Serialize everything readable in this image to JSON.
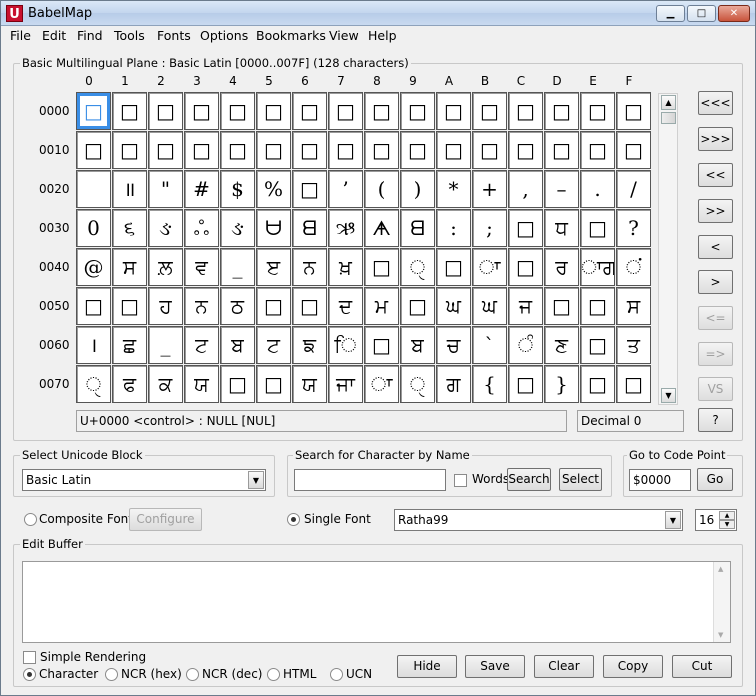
{
  "app": {
    "title": "BabelMap",
    "icon_letter": "U"
  },
  "window_controls": {
    "min": "▁",
    "max": "□",
    "close": "✕"
  },
  "menu": [
    "File",
    "Edit",
    "Find",
    "Tools",
    "Fonts",
    "Options",
    "Bookmarks",
    "View",
    "Help"
  ],
  "grid": {
    "title": "Basic Multilingual Plane : Basic Latin [0000..007F] (128 characters)",
    "columns": [
      "0",
      "1",
      "2",
      "3",
      "4",
      "5",
      "6",
      "7",
      "8",
      "9",
      "A",
      "B",
      "C",
      "D",
      "E",
      "F"
    ],
    "rows": [
      {
        "label": "0000",
        "cells": [
          "□",
          "□",
          "□",
          "□",
          "□",
          "□",
          "□",
          "□",
          "□",
          "□",
          "□",
          "□",
          "□",
          "□",
          "□",
          "□"
        ]
      },
      {
        "label": "0010",
        "cells": [
          "□",
          "□",
          "□",
          "□",
          "□",
          "□",
          "□",
          "□",
          "□",
          "□",
          "□",
          "□",
          "□",
          "□",
          "□",
          "□"
        ]
      },
      {
        "label": "0020",
        "cells": [
          "",
          "॥",
          "\"",
          "#",
          "$",
          "%",
          "□",
          "’",
          "(",
          ")",
          "*",
          "+",
          ",",
          "–",
          ".",
          "/"
        ]
      },
      {
        "label": "0030",
        "cells": [
          "0",
          "૬",
          "ઙ",
          "ஃ",
          "ઙ",
          "ᗨ",
          "ᗺ",
          "ઋ",
          "ᗗ",
          "ᗺ",
          ":",
          ";",
          "□",
          "ਧ",
          "□",
          "?"
        ]
      },
      {
        "label": "0040",
        "cells": [
          "@",
          "ਸ",
          "ਲ਼",
          "ਵ",
          "_",
          "ੲ",
          "ਨ",
          "ਖ਼",
          "□",
          "ੑ",
          "□",
          "ਾ",
          "□",
          "ਰ",
          "ਾਗ",
          "ਂ"
        ]
      },
      {
        "label": "0050",
        "cells": [
          "□",
          "□",
          "ਹ",
          "ਨ",
          "ਠ",
          "□",
          "□",
          "ਦ",
          "ਮ",
          "□",
          "ਘ",
          "ਘ",
          "ਜ",
          "□",
          "□",
          "ਸ"
        ]
      },
      {
        "label": "0060",
        "cells": [
          "।",
          "ਛ",
          "_",
          "ਟ",
          "ਬ",
          "ਟ",
          "ਙ",
          "ਿ",
          "□",
          "ਬ",
          "ਚ",
          "`",
          "ੰ",
          "ਣ",
          "□",
          "ਤ"
        ]
      },
      {
        "label": "0070",
        "cells": [
          "ੑ",
          "ਫ",
          "ਕ",
          "ਯ",
          "□",
          "□",
          "ਯ",
          "ਜਾ",
          "ਾ",
          "ੑ",
          "ਗ",
          "{",
          "□",
          "}",
          "□",
          "□"
        ]
      }
    ]
  },
  "status": {
    "char_info": "U+0000 <control> : NULL [NUL]",
    "decimal": "Decimal 0"
  },
  "nav_buttons": [
    "<<<",
    ">>>",
    "<<",
    ">>",
    "<",
    ">",
    "<=",
    "=>",
    "VS",
    "?"
  ],
  "unicode_block": {
    "title": "Select Unicode Block",
    "value": "Basic Latin"
  },
  "search": {
    "title": "Search for Character by Name",
    "value": "",
    "words_label": "Words",
    "search_label": "Search",
    "select_label": "Select"
  },
  "goto": {
    "title": "Go to Code Point",
    "value": "$0000",
    "go_label": "Go"
  },
  "font": {
    "composite_label": "Composite Font",
    "configure_label": "Configure",
    "single_label": "Single Font",
    "font_name": "Ratha99",
    "size": "16"
  },
  "edit_buffer": {
    "title": "Edit Buffer",
    "value": ""
  },
  "options": {
    "simple_rendering": "Simple Rendering",
    "formats": [
      "Character",
      "NCR (hex)",
      "NCR (dec)",
      "HTML",
      "UCN"
    ]
  },
  "actions": [
    "Hide",
    "Save",
    "Clear",
    "Copy",
    "Cut"
  ]
}
